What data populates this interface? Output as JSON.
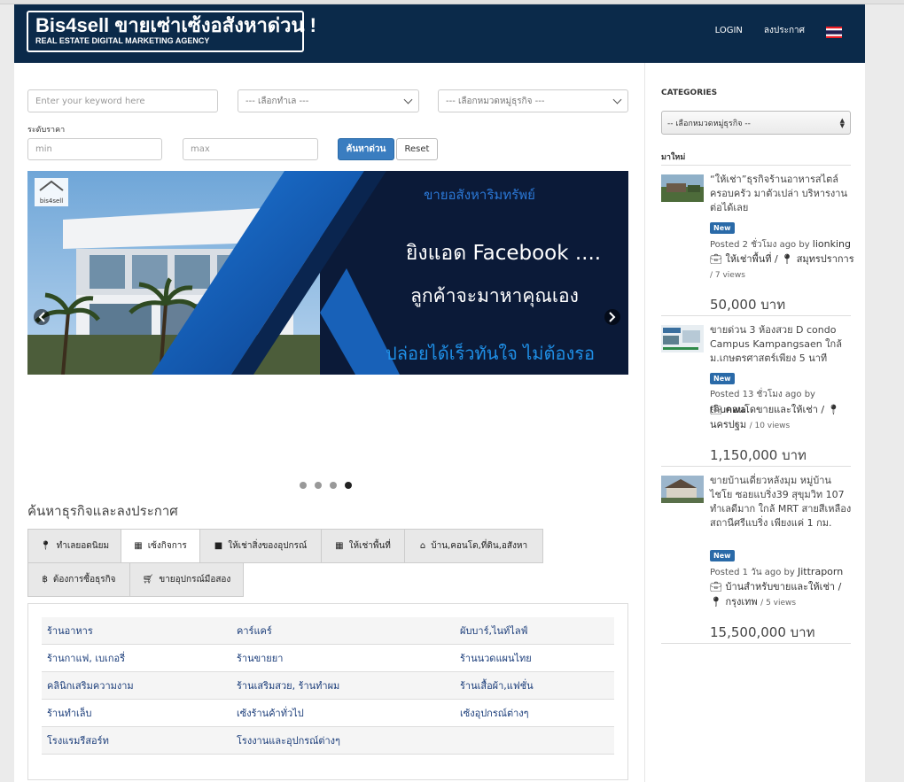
{
  "header": {
    "brand_title": "Bis4sell ขายเซ่าเซ้งอสังหาด่วน !",
    "brand_subtitle": "REAL ESTATE DIGITAL MARKETING AGENCY",
    "login": "LOGIN",
    "post": "ลงประกาศ",
    "flag_icon": "thai-flag-icon"
  },
  "search": {
    "keyword_placeholder": "Enter your keyword here",
    "location_select": "--- เลือกทำเล ---",
    "category_select": "--- เลือกหมวดหมู่ธุรกิจ ---",
    "price_label": "ระดับราคา",
    "min_placeholder": "min",
    "max_placeholder": "max",
    "search_button": "ค้นหาด่วน",
    "reset_button": "Reset"
  },
  "banner": {
    "logo_text": "bis4sell",
    "line1": "ขายอสังหาริมทรัพย์",
    "line2": "ยิงแอด Facebook ....",
    "line3": "ลูกค้าจะมาหาคุณเอง",
    "line4": "ปล่อยได้เร็วทันใจ ไม่ต้องรอ",
    "slide_count": 4,
    "active_slide": 4
  },
  "section": {
    "title": "ค้นหาธุรกิจและลงประกาศ",
    "tabs": [
      {
        "label": "ทำเลยอดนิยม",
        "icon": "map-marker-icon"
      },
      {
        "label": "เซ้งกิจการ",
        "icon": "building-icon"
      },
      {
        "label": "ให้เช่าสิ่งของอุปกรณ์",
        "icon": "archive-icon"
      },
      {
        "label": "ให้เช่าพื้นที่",
        "icon": "building-icon"
      },
      {
        "label": "บ้าน,คอนโด,ที่ดิน,อสังหา",
        "icon": "home-icon"
      },
      {
        "label": "ต้องการซื้อธุรกิจ",
        "icon": "bitcoin-icon"
      },
      {
        "label": "ขายอุปกรณ์มือสอง",
        "icon": "cart-icon"
      }
    ],
    "categories": [
      [
        "ร้านอาหาร",
        "คาร์แคร์",
        "ผับบาร์,ไนท์ไลฟ์"
      ],
      [
        "ร้านกาแฟ, เบเกอรี่",
        "ร้านขายยา",
        "ร้านนวดแผนไทย"
      ],
      [
        "คลินิกเสริมความงาม",
        "ร้านเสริมสวย, ร้านทำผม",
        "ร้านเสื้อผ้า,แฟชั่น"
      ],
      [
        "ร้านทำเล็บ",
        "เซ้งร้านค้าทั่วไป",
        "เซ้งอุปกรณ์ต่างๆ"
      ],
      [
        "โรงแรมรีสอร์ท",
        "โรงงานและอุปกรณ์ต่างๆ",
        ""
      ]
    ]
  },
  "sidebar": {
    "categories_heading": "CATEGORIES",
    "category_select": "-- เลือกหมวดหมู่ธุรกิจ --",
    "new_heading": "มาใหม่",
    "listings": [
      {
        "title": "“ให้เช่า”ธุรกิจร้านอาหารสไตล์ครอบครัว มาตัวเปล่า บริหารงานต่อได้เลย",
        "badge": "New",
        "posted": "Posted 2 ชั่วโมง ago by",
        "author": "lionking",
        "category": "ให้เช่าพื้นที่ /",
        "location": "สมุทรปราการ",
        "views": "/ 7 views",
        "price": "50,000 บาท"
      },
      {
        "title": "ขายด่วน 3 ห้องสวย D condo Campus Kampangsaen ใกล้ ม.เกษตรศาสตร์เพียง 5 นาที",
        "badge": "New",
        "posted": "Posted 13 ชั่วโมง ago by",
        "author": "thunwa",
        "category": "คอนโดขายและให้เช่า /",
        "location": "นครปฐม",
        "views": "/ 10 views",
        "price": "1,150,000 บาท"
      },
      {
        "title": "ขายบ้านเดี่ยวหลังมุม หมู่บ้านไชโย ซอยแบริ่ง39 สุขุมวิท 107 ทำเลดีมาก ใกล้ MRT สายสีเหลือง สถานีศรีแบริ่ง เพียงแค่ 1 กม.",
        "badge": "New",
        "posted": "Posted 1 วัน ago by",
        "author": "Jittraporn",
        "category": "บ้านสำหรับขายและให้เช่า /",
        "location": "กรุงเทพ",
        "views": "/ 5 views",
        "price": "15,500,000 บาท"
      }
    ]
  }
}
